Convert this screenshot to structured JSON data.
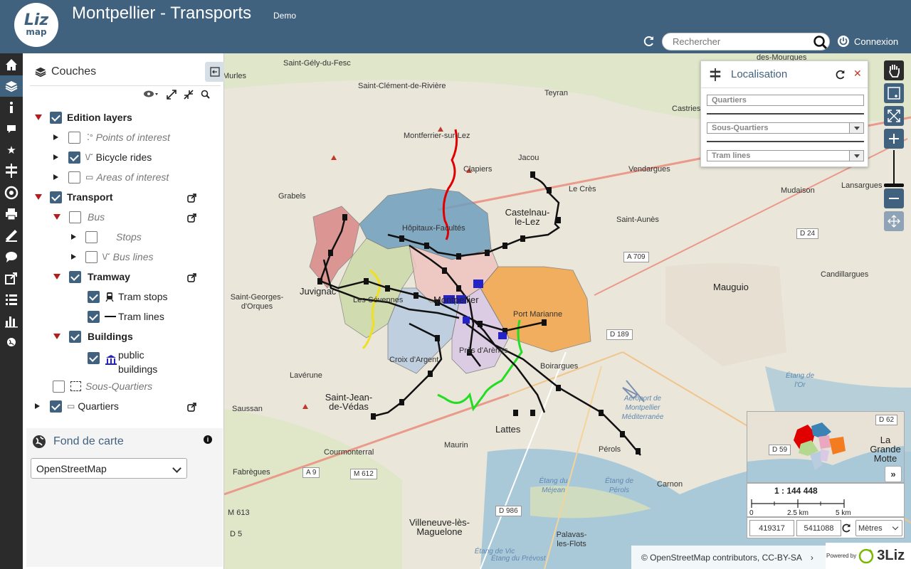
{
  "header": {
    "title": "Montpellier - Transports",
    "subtitle": "Demo",
    "logo_top": "Liz",
    "logo_bottom": "map",
    "search_placeholder": "Rechercher",
    "login_label": "Connexion"
  },
  "menu": {
    "items": [
      "home-icon",
      "layers-icon",
      "info-icon",
      "comment-icon",
      "star-icon",
      "location-icon",
      "target-icon",
      "print-icon",
      "measure-icon",
      "chat-icon",
      "share-icon",
      "list-icon",
      "chart-icon",
      "globe-icon"
    ],
    "active": "layers-icon"
  },
  "layers_panel": {
    "title": "Couches",
    "layers": [
      {
        "label": "Edition layers",
        "checked": true,
        "expanded": true
      },
      {
        "label": "Points of interest",
        "checked": false,
        "expanded": false
      },
      {
        "label": "Bicycle rides",
        "checked": true,
        "expanded": false
      },
      {
        "label": "Areas of interest",
        "checked": false,
        "expanded": false
      },
      {
        "label": "Transport",
        "checked": true,
        "expanded": true
      },
      {
        "label": "Bus",
        "checked": false,
        "expanded": true
      },
      {
        "label": "Stops",
        "checked": false,
        "expanded": false
      },
      {
        "label": "Bus lines",
        "checked": false,
        "expanded": false
      },
      {
        "label": "Tramway",
        "checked": true,
        "expanded": true
      },
      {
        "label": "Tram stops",
        "checked": true
      },
      {
        "label": "Tram lines",
        "checked": true
      },
      {
        "label": "Buildings",
        "checked": true,
        "expanded": true
      },
      {
        "label": "public buildings",
        "checked": true
      },
      {
        "label": "Sous-Quartiers",
        "checked": false
      },
      {
        "label": "Quartiers",
        "checked": true,
        "expanded": false
      }
    ]
  },
  "basemap": {
    "title": "Fond de carte",
    "info_label": "i",
    "selected": "OpenStreetMap"
  },
  "localisation": {
    "title": "Localisation",
    "fields": [
      "Quartiers",
      "Sous-Quartiers",
      "Tram lines"
    ]
  },
  "map": {
    "places": [
      "Saint-Gély-du-Fesc",
      "Saint-Clément-de-Rivière",
      "Teyran",
      "Castries",
      "Montferrier-sur-Lez",
      "Clapiers",
      "Jacou",
      "Vendargues",
      "Grabels",
      "Le Crès",
      "Castelnau-le-Lez",
      "Hôpitaux-Facultés",
      "Saint-Aunès",
      "Mudaison",
      "Lansargues",
      "Juvignac",
      "Saint-Georges-d'Orques",
      "Les Cévennes",
      "Montpellier",
      "Port Marianne",
      "Mauguio",
      "Candillargues",
      "Croix d'Argent",
      "Près d'Arènes",
      "Boirargues",
      "Lavérune",
      "Saint-Jean-de-Védas",
      "Saussan",
      "Lattes",
      "Maurin",
      "Fabrègues",
      "Pérols",
      "Carnon",
      "Villeneuve-lès-Maguelone",
      "Palavas-les-Flots",
      "Étang de l'Or",
      "Aéroport de Montpellier Méditerranée",
      "Étang du Méjean",
      "Étang de Pérols",
      "Étang de Vic",
      "Étang du Prévost",
      "La Grande Motte",
      "des-Mourgues",
      "Murles",
      "Courmonterral"
    ],
    "roads": [
      "A 709",
      "D 24",
      "D 189",
      "A 9",
      "M 612",
      "D 986",
      "D 5",
      "M 613",
      "D 59",
      "D 62"
    ]
  },
  "overview": {
    "toggle": "»",
    "scale_label": "1 : 144 448",
    "scale_ticks": [
      "0",
      "2.5 km",
      "5 km"
    ],
    "coord_x": "419317",
    "coord_y": "5411088",
    "unit": "Mètres"
  },
  "footer": {
    "attribution": "© OpenStreetMap contributors, CC-BY-SA",
    "attribution_arrow": "›",
    "powered_by": "Powered by",
    "brand": "3Liz"
  },
  "colors": {
    "header": "#41627f",
    "menu": "#2b2b2b",
    "accent": "#41627f"
  }
}
